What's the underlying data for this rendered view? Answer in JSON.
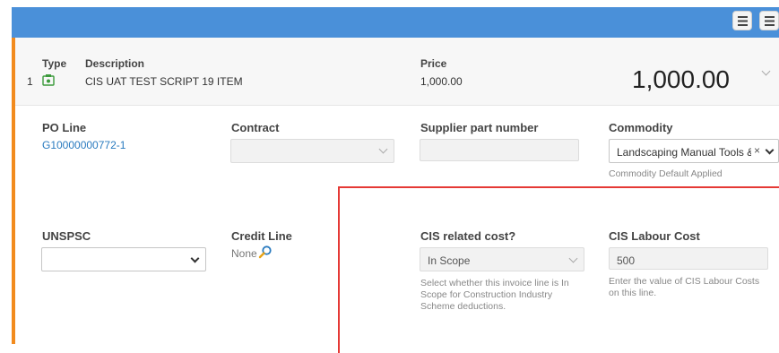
{
  "line": {
    "number": "1",
    "type_label": "Type",
    "description_label": "Description",
    "description": "CIS UAT TEST SCRIPT 19 ITEM",
    "price_label": "Price",
    "price_value": "1,000.00",
    "total": "1,000.00"
  },
  "po_line": {
    "label": "PO Line",
    "value": "G10000000772-1"
  },
  "contract": {
    "label": "Contract",
    "value": ""
  },
  "supplier_part": {
    "label": "Supplier part number",
    "value": ""
  },
  "commodity": {
    "label": "Commodity",
    "value": "Landscaping Manual Tools & Equipment",
    "clear": "×",
    "note": "Commodity Default Applied"
  },
  "unspsc": {
    "label": "UNSPSC",
    "value": ""
  },
  "credit_line": {
    "label": "Credit Line",
    "value": "None"
  },
  "cis_related": {
    "label": "CIS related cost?",
    "value": "In Scope",
    "help": "Select whether this invoice line is In Scope for Construction Industry Scheme deductions."
  },
  "cis_labour": {
    "label": "CIS Labour Cost",
    "value": "500",
    "help": "Enter the value of CIS Labour Costs on this line."
  },
  "colors": {
    "header": "#4a90d9",
    "accent": "#f28b1e",
    "highlight": "#e53935",
    "link": "#2a7bbf"
  }
}
